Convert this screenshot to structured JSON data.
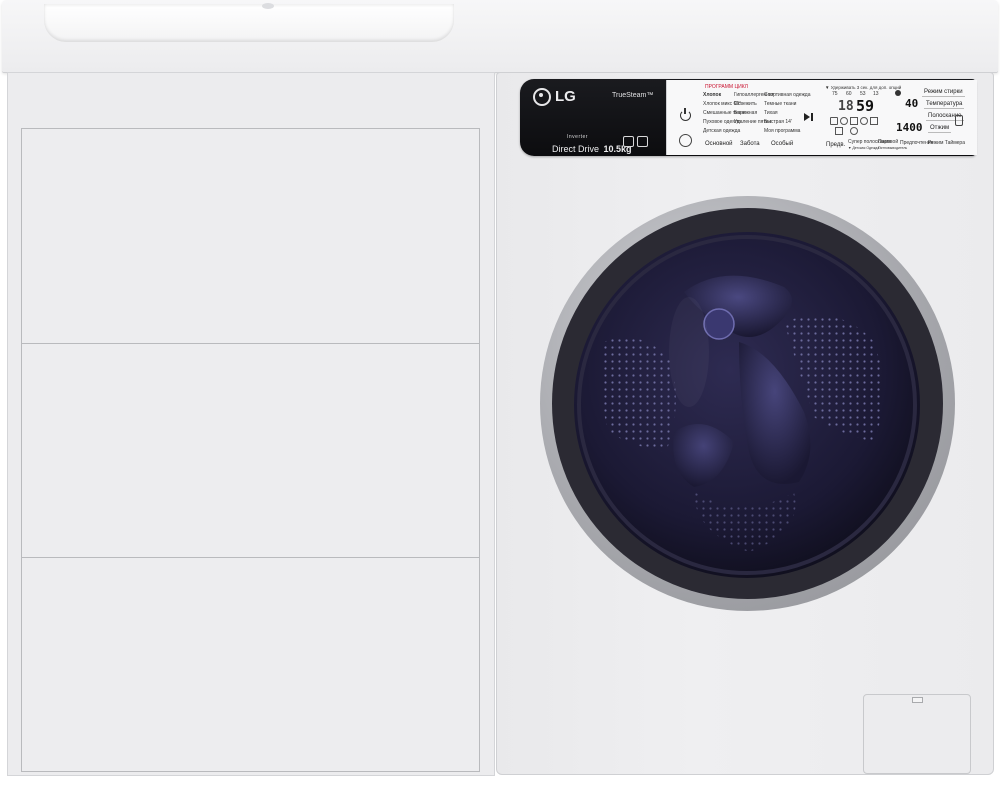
{
  "brand": {
    "logo_text": "LG",
    "truesteam": "TrueSteam™",
    "inverter": "Inverter",
    "direct_drive": "Direct Drive",
    "capacity": "10.5kg"
  },
  "programs": {
    "top_label": "ПРОГРАММ ЦИКЛ",
    "col1": [
      "Хлопок",
      "Хлопок микс 60°",
      "Смешанные ткани",
      "Пуховое одеяло",
      "Детская одежда"
    ],
    "col2": [
      "Гипоаллергенная",
      "Освежить",
      "Бережная",
      "Удаление пятен"
    ],
    "col3": [
      "Спортивная одежда",
      "Темные ткани",
      "Тихая",
      "Быстрая 14'",
      "Моя программа"
    ]
  },
  "program_groups": [
    "Основной",
    "Забота",
    "Особый"
  ],
  "display": {
    "hint": "▼ Удерживать 3 сек. для доп. опций",
    "time_hours": "18",
    "time_minutes": "59",
    "temperature": "40",
    "spin": "1400",
    "small_top": [
      "75",
      "60",
      "53",
      "13"
    ]
  },
  "options": {
    "right_col": [
      "Режим стирки",
      "Температура",
      "Полоскание",
      "Отжим"
    ],
    "bottom": [
      "Предв.",
      "Супер полоскание",
      "Паровой",
      "Предпочтения",
      "Режим Таймера"
    ],
    "bottom_sub": [
      "",
      "▼ Детская Одежда",
      "Пятновыводитель",
      "",
      ""
    ]
  },
  "colors": {
    "panel_black": "#0f0f12",
    "body_white": "#ececee",
    "glass_dark": "#1b1934",
    "accent_red": "#c8102e"
  },
  "icons": [
    "power-icon",
    "start-pause-icon",
    "tub-clean-icon",
    "wifi-icon",
    "smart-diagnosis-icon"
  ]
}
